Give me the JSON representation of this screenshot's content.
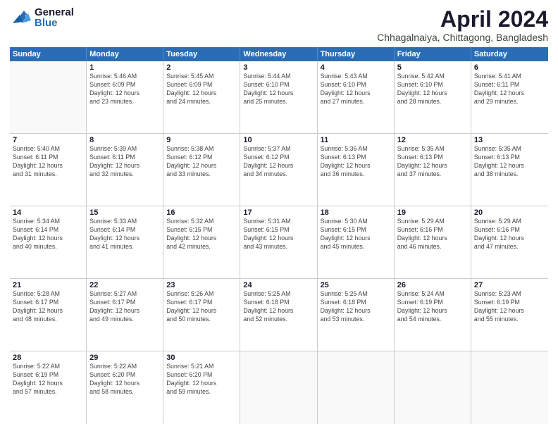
{
  "header": {
    "logo_general": "General",
    "logo_blue": "Blue",
    "month_title": "April 2024",
    "subtitle": "Chhagalnaiya, Chittagong, Bangladesh"
  },
  "days_of_week": [
    "Sunday",
    "Monday",
    "Tuesday",
    "Wednesday",
    "Thursday",
    "Friday",
    "Saturday"
  ],
  "weeks": [
    [
      {
        "day": "",
        "info": ""
      },
      {
        "day": "1",
        "info": "Sunrise: 5:46 AM\nSunset: 6:09 PM\nDaylight: 12 hours\nand 23 minutes."
      },
      {
        "day": "2",
        "info": "Sunrise: 5:45 AM\nSunset: 6:09 PM\nDaylight: 12 hours\nand 24 minutes."
      },
      {
        "day": "3",
        "info": "Sunrise: 5:44 AM\nSunset: 6:10 PM\nDaylight: 12 hours\nand 25 minutes."
      },
      {
        "day": "4",
        "info": "Sunrise: 5:43 AM\nSunset: 6:10 PM\nDaylight: 12 hours\nand 27 minutes."
      },
      {
        "day": "5",
        "info": "Sunrise: 5:42 AM\nSunset: 6:10 PM\nDaylight: 12 hours\nand 28 minutes."
      },
      {
        "day": "6",
        "info": "Sunrise: 5:41 AM\nSunset: 6:11 PM\nDaylight: 12 hours\nand 29 minutes."
      }
    ],
    [
      {
        "day": "7",
        "info": "Sunrise: 5:40 AM\nSunset: 6:11 PM\nDaylight: 12 hours\nand 31 minutes."
      },
      {
        "day": "8",
        "info": "Sunrise: 5:39 AM\nSunset: 6:11 PM\nDaylight: 12 hours\nand 32 minutes."
      },
      {
        "day": "9",
        "info": "Sunrise: 5:38 AM\nSunset: 6:12 PM\nDaylight: 12 hours\nand 33 minutes."
      },
      {
        "day": "10",
        "info": "Sunrise: 5:37 AM\nSunset: 6:12 PM\nDaylight: 12 hours\nand 34 minutes."
      },
      {
        "day": "11",
        "info": "Sunrise: 5:36 AM\nSunset: 6:13 PM\nDaylight: 12 hours\nand 36 minutes."
      },
      {
        "day": "12",
        "info": "Sunrise: 5:35 AM\nSunset: 6:13 PM\nDaylight: 12 hours\nand 37 minutes."
      },
      {
        "day": "13",
        "info": "Sunrise: 5:35 AM\nSunset: 6:13 PM\nDaylight: 12 hours\nand 38 minutes."
      }
    ],
    [
      {
        "day": "14",
        "info": "Sunrise: 5:34 AM\nSunset: 6:14 PM\nDaylight: 12 hours\nand 40 minutes."
      },
      {
        "day": "15",
        "info": "Sunrise: 5:33 AM\nSunset: 6:14 PM\nDaylight: 12 hours\nand 41 minutes."
      },
      {
        "day": "16",
        "info": "Sunrise: 5:32 AM\nSunset: 6:15 PM\nDaylight: 12 hours\nand 42 minutes."
      },
      {
        "day": "17",
        "info": "Sunrise: 5:31 AM\nSunset: 6:15 PM\nDaylight: 12 hours\nand 43 minutes."
      },
      {
        "day": "18",
        "info": "Sunrise: 5:30 AM\nSunset: 6:15 PM\nDaylight: 12 hours\nand 45 minutes."
      },
      {
        "day": "19",
        "info": "Sunrise: 5:29 AM\nSunset: 6:16 PM\nDaylight: 12 hours\nand 46 minutes."
      },
      {
        "day": "20",
        "info": "Sunrise: 5:29 AM\nSunset: 6:16 PM\nDaylight: 12 hours\nand 47 minutes."
      }
    ],
    [
      {
        "day": "21",
        "info": "Sunrise: 5:28 AM\nSunset: 6:17 PM\nDaylight: 12 hours\nand 48 minutes."
      },
      {
        "day": "22",
        "info": "Sunrise: 5:27 AM\nSunset: 6:17 PM\nDaylight: 12 hours\nand 49 minutes."
      },
      {
        "day": "23",
        "info": "Sunrise: 5:26 AM\nSunset: 6:17 PM\nDaylight: 12 hours\nand 50 minutes."
      },
      {
        "day": "24",
        "info": "Sunrise: 5:25 AM\nSunset: 6:18 PM\nDaylight: 12 hours\nand 52 minutes."
      },
      {
        "day": "25",
        "info": "Sunrise: 5:25 AM\nSunset: 6:18 PM\nDaylight: 12 hours\nand 53 minutes."
      },
      {
        "day": "26",
        "info": "Sunrise: 5:24 AM\nSunset: 6:19 PM\nDaylight: 12 hours\nand 54 minutes."
      },
      {
        "day": "27",
        "info": "Sunrise: 5:23 AM\nSunset: 6:19 PM\nDaylight: 12 hours\nand 55 minutes."
      }
    ],
    [
      {
        "day": "28",
        "info": "Sunrise: 5:22 AM\nSunset: 6:19 PM\nDaylight: 12 hours\nand 57 minutes."
      },
      {
        "day": "29",
        "info": "Sunrise: 5:22 AM\nSunset: 6:20 PM\nDaylight: 12 hours\nand 58 minutes."
      },
      {
        "day": "30",
        "info": "Sunrise: 5:21 AM\nSunset: 6:20 PM\nDaylight: 12 hours\nand 59 minutes."
      },
      {
        "day": "",
        "info": ""
      },
      {
        "day": "",
        "info": ""
      },
      {
        "day": "",
        "info": ""
      },
      {
        "day": "",
        "info": ""
      }
    ]
  ]
}
